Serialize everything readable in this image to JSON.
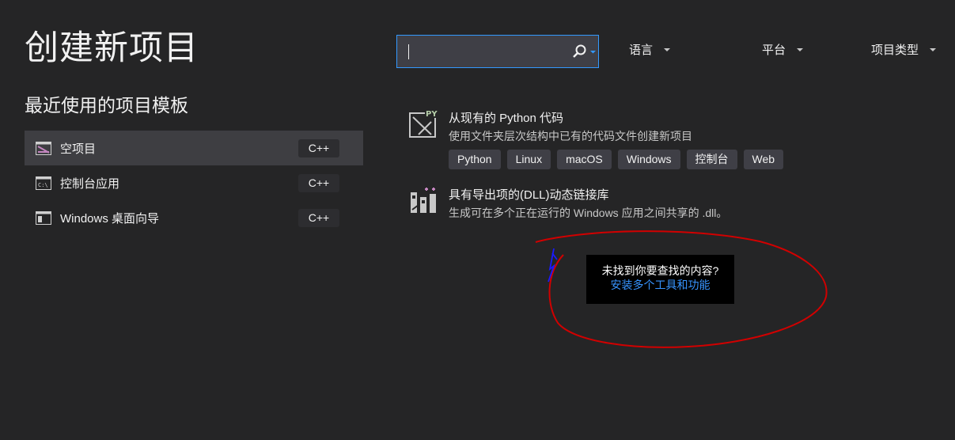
{
  "page": {
    "title": "创建新项目"
  },
  "recent": {
    "title": "最近使用的项目模板",
    "items": [
      {
        "label": "空项目",
        "lang": "C++",
        "icon": "empty-project-icon"
      },
      {
        "label": "控制台应用",
        "lang": "C++",
        "icon": "console-app-icon"
      },
      {
        "label": "Windows 桌面向导",
        "lang": "C++",
        "icon": "windows-desktop-icon"
      }
    ]
  },
  "search": {
    "value": "",
    "placeholder": "",
    "icon": "search-icon"
  },
  "filters": {
    "language": "语言",
    "platform": "平台",
    "project_type": "项目类型"
  },
  "templates": [
    {
      "name": "从现有的 Python 代码",
      "description": "使用文件夹层次结构中已有的代码文件创建新项目",
      "icon": "python-from-code-icon",
      "tags": [
        "Python",
        "Linux",
        "macOS",
        "Windows",
        "控制台",
        "Web"
      ]
    },
    {
      "name": "具有导出项的(DLL)动态链接库",
      "description": "生成可在多个正在运行的 Windows 应用之间共享的 .dll。",
      "icon": "dll-library-icon",
      "tags": []
    }
  ],
  "not_found": {
    "question": "未找到你要查找的内容?",
    "link": "安装多个工具和功能"
  },
  "colors": {
    "background": "#252526",
    "selected": "#3e3e42",
    "accent": "#3399ff",
    "link": "#3794ff",
    "annotation_red": "#d10000",
    "annotation_blue": "#1a1aff"
  }
}
